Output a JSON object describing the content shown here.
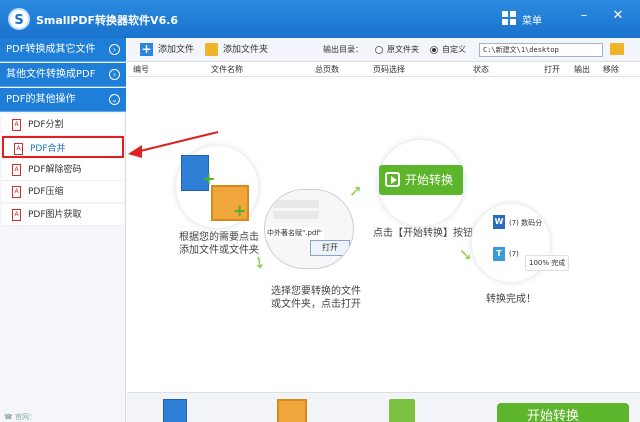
{
  "titlebar": {
    "app_title": "SmallPDF转换器软件V6.6",
    "logo_letter": "S",
    "menu_label": "菜单",
    "minimize": "–",
    "close": "✕"
  },
  "sidebar": {
    "categories": [
      {
        "label": "PDF转换成其它文件",
        "chevron": "›"
      },
      {
        "label": "其他文件转换成PDF",
        "chevron": "›"
      },
      {
        "label": "PDF的其他操作",
        "chevron": "⌄"
      }
    ],
    "items": [
      {
        "label": "PDF分割",
        "active": false
      },
      {
        "label": "PDF合并",
        "active": true
      },
      {
        "label": "PDF解除密码",
        "active": false
      },
      {
        "label": "PDF压缩",
        "active": false
      },
      {
        "label": "PDF图片获取",
        "active": false
      }
    ],
    "footer": "☎ 官网："
  },
  "toolbar": {
    "add_file_label": "添加文件",
    "add_folder_label": "添加文件夹",
    "output_label": "输出目录：",
    "radio_original": "原文件夹",
    "radio_custom": "自定义",
    "path_value": "C:\\新建文\\1\\desktop"
  },
  "table": {
    "columns": [
      "编号",
      "文件名称",
      "总页数",
      "页码选择",
      "状态",
      "打开",
      "输出",
      "移除"
    ]
  },
  "guide": {
    "step1_caption": "根据您的需要点击\n添加文件或文件夹",
    "step2_caption": "选择您要转换的文件\n或文件夹，点击打开",
    "step2_filename": "中外著名赋\".pdf\"",
    "step2_open_btn": "打开",
    "step3_button": "开始转换",
    "step3_caption": "点击【开始转换】按钮",
    "step4_caption": "转换完成！",
    "step4_row1": "(7) 数码分",
    "step4_row2": "(7)",
    "step4_percent": "100%  完成"
  },
  "bottom": {
    "start_label": "开始转换"
  },
  "colors": {
    "brand_blue": "#1f7fd8",
    "start_green": "#5cb52a",
    "highlight_red": "#e02020"
  }
}
